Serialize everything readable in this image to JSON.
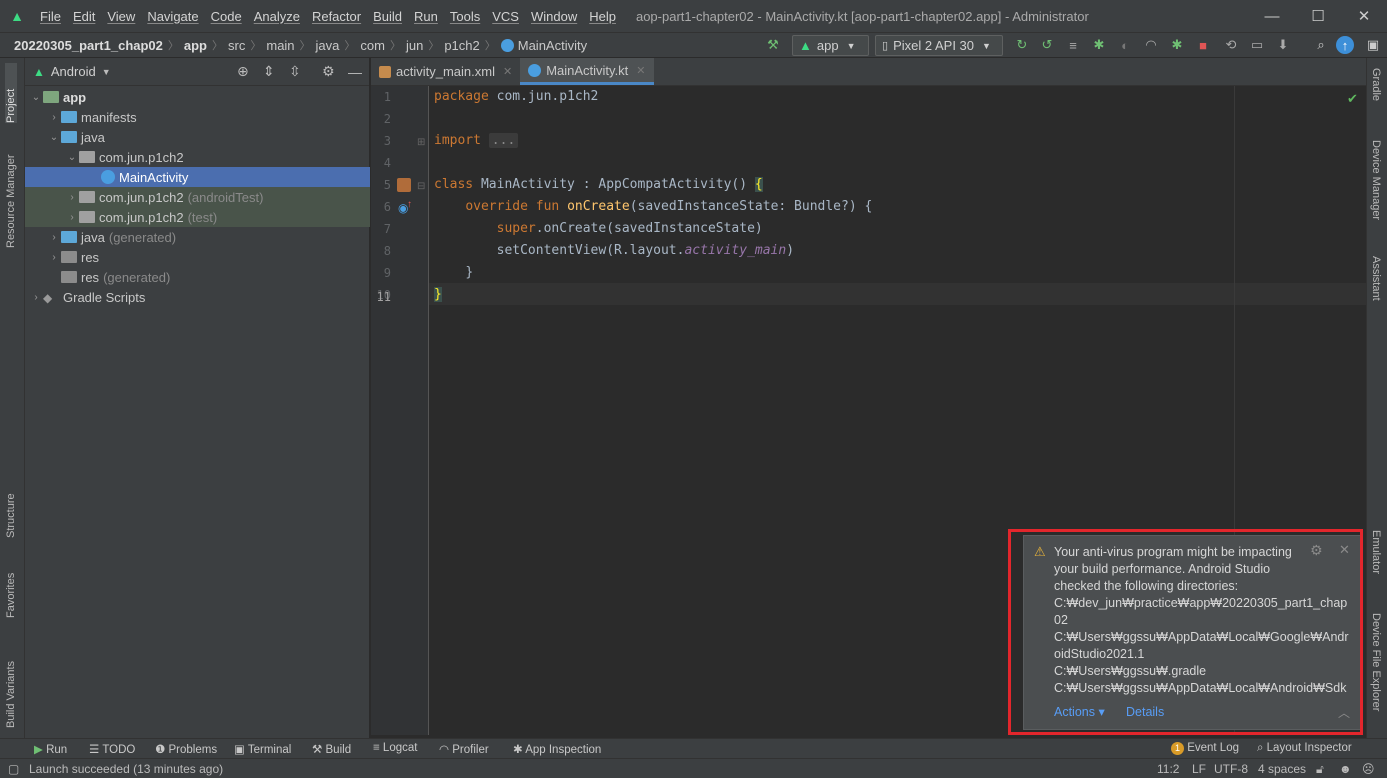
{
  "titlebar": {
    "menus": [
      "File",
      "Edit",
      "View",
      "Navigate",
      "Code",
      "Analyze",
      "Refactor",
      "Build",
      "Run",
      "Tools",
      "VCS",
      "Window",
      "Help"
    ],
    "title": "aop-part1-chapter02 - MainActivity.kt [aop-part1-chapter02.app] - Administrator"
  },
  "navbar": {
    "breadcrumbs": [
      "20220305_part1_chap02",
      "app",
      "src",
      "main",
      "java",
      "com",
      "jun",
      "p1ch2",
      "MainActivity"
    ]
  },
  "toolbar": {
    "run_config": "app",
    "device": "Pixel 2 API 30"
  },
  "left_tabs": {
    "project": "Project",
    "resource_manager": "Resource Manager",
    "structure": "Structure",
    "favorites": "Favorites",
    "build_variants": "Build Variants"
  },
  "right_tabs": {
    "gradle": "Gradle",
    "device_manager": "Device Manager",
    "assistant": "Assistant",
    "emulator": "Emulator",
    "device_file_explorer": "Device File Explorer"
  },
  "project": {
    "view_mode": "Android",
    "tree": [
      {
        "label": "app",
        "suffix": ""
      },
      {
        "label": "manifests",
        "suffix": ""
      },
      {
        "label": "java",
        "suffix": ""
      },
      {
        "label": "com.jun.p1ch2",
        "suffix": ""
      },
      {
        "label": "MainActivity",
        "suffix": ""
      },
      {
        "label": "com.jun.p1ch2",
        "suffix": "(androidTest)"
      },
      {
        "label": "com.jun.p1ch2",
        "suffix": "(test)"
      },
      {
        "label": "java",
        "suffix": "(generated)"
      },
      {
        "label": "res",
        "suffix": ""
      },
      {
        "label": "res",
        "suffix": "(generated)"
      },
      {
        "label": "Gradle Scripts",
        "suffix": ""
      }
    ]
  },
  "editor": {
    "tabs": [
      "activity_main.xml",
      "MainActivity.kt"
    ],
    "line_numbers": [
      "1",
      "2",
      "3",
      "4",
      "5",
      "6",
      "7",
      "8",
      "9",
      "10",
      "11"
    ],
    "code": {
      "l1_kw": "package",
      "l1_rest": " com.jun.p1ch2",
      "l3_kw": "import",
      "l3_fold": "...",
      "l6_kw": "class",
      "l6_rest": " MainActivity : AppCompatActivity() ",
      "l6_brace": "{",
      "l7_kw": "override fun",
      "l7_fn": "onCreate",
      "l7_rest": "(savedInstanceState: Bundle?) {",
      "l8_kw": "super",
      "l8_rest": ".onCreate(savedInstanceState)",
      "l9_rest": "setContentView(R.layout.",
      "l9_it": "activity_main",
      "l9_end": ")",
      "l10": "}",
      "l11": "}"
    }
  },
  "notification": {
    "lines": [
      "Your anti-virus program might be impacting",
      "your build performance. Android Studio",
      "checked the following directories:",
      "C:₩dev_jun₩practice₩app₩20220305_part1_chap",
      "02",
      "C:₩Users₩ggssu₩AppData₩Local₩Google₩Andr",
      "oidStudio2021.1",
      "C:₩Users₩ggssu₩.gradle",
      "C:₩Users₩ggssu₩AppData₩Local₩Android₩Sdk"
    ],
    "actions": "Actions",
    "details": "Details",
    "accent": "#e3262c"
  },
  "bottom_tools": [
    "Run",
    "TODO",
    "Problems",
    "Terminal",
    "Build",
    "Logcat",
    "Profiler",
    "App Inspection",
    "Event Log",
    "Layout Inspector"
  ],
  "event_log_count": "1",
  "status": {
    "message": "Launch succeeded (13 minutes ago)",
    "position": "11:2",
    "line_sep": "LF",
    "encoding": "UTF-8",
    "indent": "4 spaces"
  }
}
